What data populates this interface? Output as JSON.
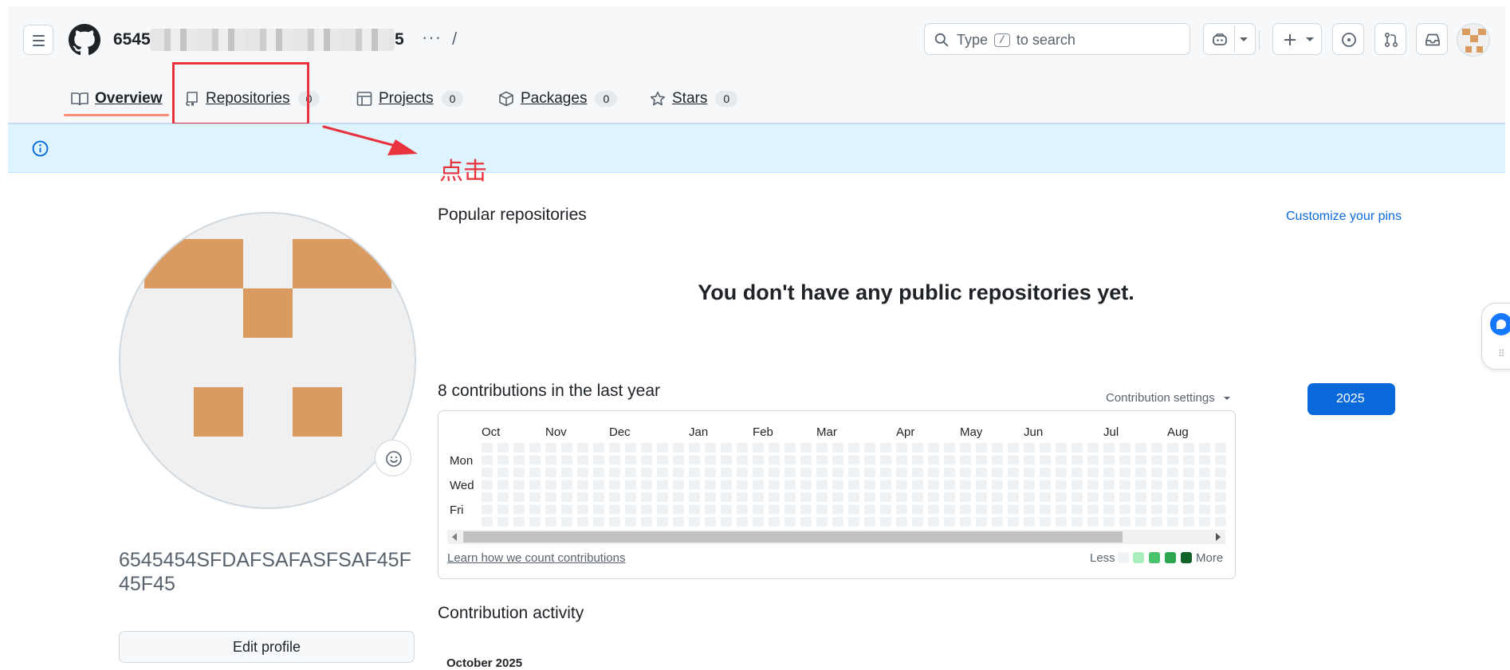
{
  "header": {
    "owner_prefix": "6545",
    "owner_suffix": "5",
    "more_dots": "···",
    "path_slash": "/",
    "search": {
      "type_text": "Type",
      "key": "/",
      "rest_text": "to search"
    }
  },
  "tabs": [
    {
      "label": "Overview",
      "icon": "book-icon"
    },
    {
      "label": "Repositories",
      "icon": "repo-icon",
      "count": "0"
    },
    {
      "label": "Projects",
      "icon": "table-icon",
      "count": "0"
    },
    {
      "label": "Packages",
      "icon": "package-icon",
      "count": "0"
    },
    {
      "label": "Stars",
      "icon": "star-icon",
      "count": "0"
    }
  ],
  "annotation": {
    "text": "点击",
    "color": "#e8323c"
  },
  "profile": {
    "username": "6545454SFDAFSAFASFSAF45F45F45",
    "edit_button": "Edit profile"
  },
  "popular": {
    "title": "Popular repositories",
    "customize_link": "Customize your pins",
    "empty_message": "You don't have any public repositories yet."
  },
  "contributions": {
    "title": "8 contributions in the last year",
    "settings_label": "Contribution settings",
    "year": "2025",
    "months": [
      "Oct",
      "Nov",
      "Dec",
      "Jan",
      "Feb",
      "Mar",
      "Apr",
      "May",
      "Jun",
      "Jul",
      "Aug"
    ],
    "day_labels": [
      "Mon",
      "Wed",
      "Fri"
    ],
    "learn_link": "Learn how we count contributions",
    "legend_less": "Less",
    "legend_more": "More",
    "legend_colors": [
      "#eff2f5",
      "#aceebb",
      "#4ac26b",
      "#2da44e",
      "#116329"
    ]
  },
  "activity": {
    "title": "Contribution activity",
    "month_label": "October 2025"
  },
  "colors": {
    "accent": "#0969da",
    "tab_underline": "#fd8c73",
    "banner_bg": "#ddf4ff",
    "avatar_fill": "#d99b5f"
  }
}
